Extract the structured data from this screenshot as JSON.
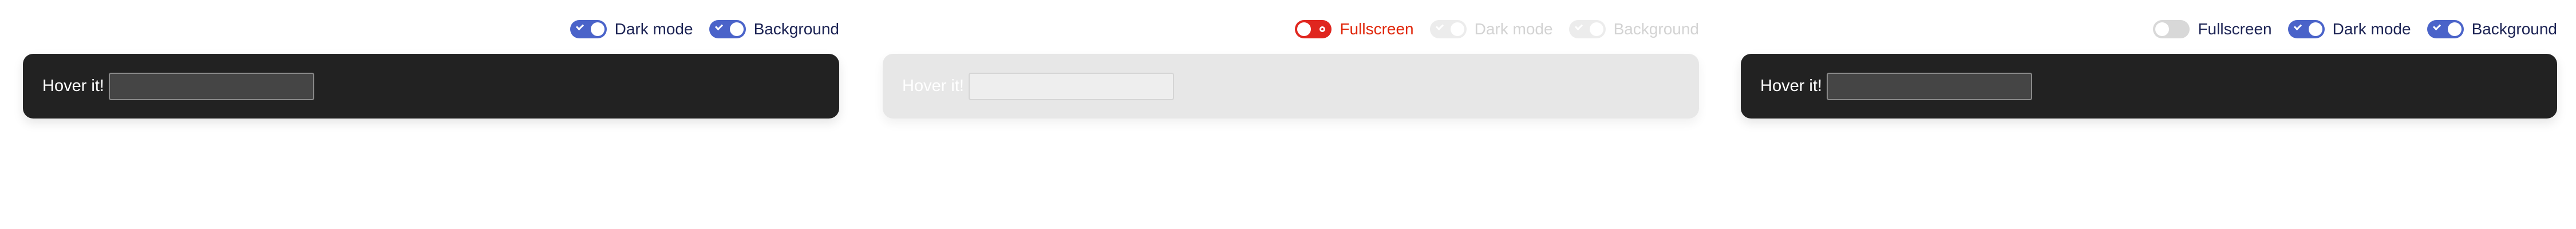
{
  "panels": [
    {
      "toggles": [
        {
          "label": "Dark mode",
          "state": "on"
        },
        {
          "label": "Background",
          "state": "on"
        }
      ],
      "card": {
        "label": "Hover it!",
        "input_value": ""
      }
    },
    {
      "toggles": [
        {
          "label": "Fullscreen",
          "state": "on"
        },
        {
          "label": "Dark mode",
          "state": "disabled"
        },
        {
          "label": "Background",
          "state": "disabled"
        }
      ],
      "card": {
        "label": "Hover it!",
        "input_value": ""
      }
    },
    {
      "toggles": [
        {
          "label": "Fullscreen",
          "state": "off"
        },
        {
          "label": "Dark mode",
          "state": "on"
        },
        {
          "label": "Background",
          "state": "on"
        }
      ],
      "card": {
        "label": "Hover it!",
        "input_value": ""
      }
    }
  ],
  "colors": {
    "toggle_on": "#4a63c9",
    "toggle_danger": "#e0261f",
    "toggle_off": "#d8d8d8",
    "toggle_disabled": "#ececec",
    "dark_card": "#222222",
    "light_card": "#e7e7e7",
    "label_dark_text": "#1c2354",
    "label_warning_text": "#e0260a"
  },
  "icons": [
    "check-icon",
    "toggle-dot-icon"
  ]
}
